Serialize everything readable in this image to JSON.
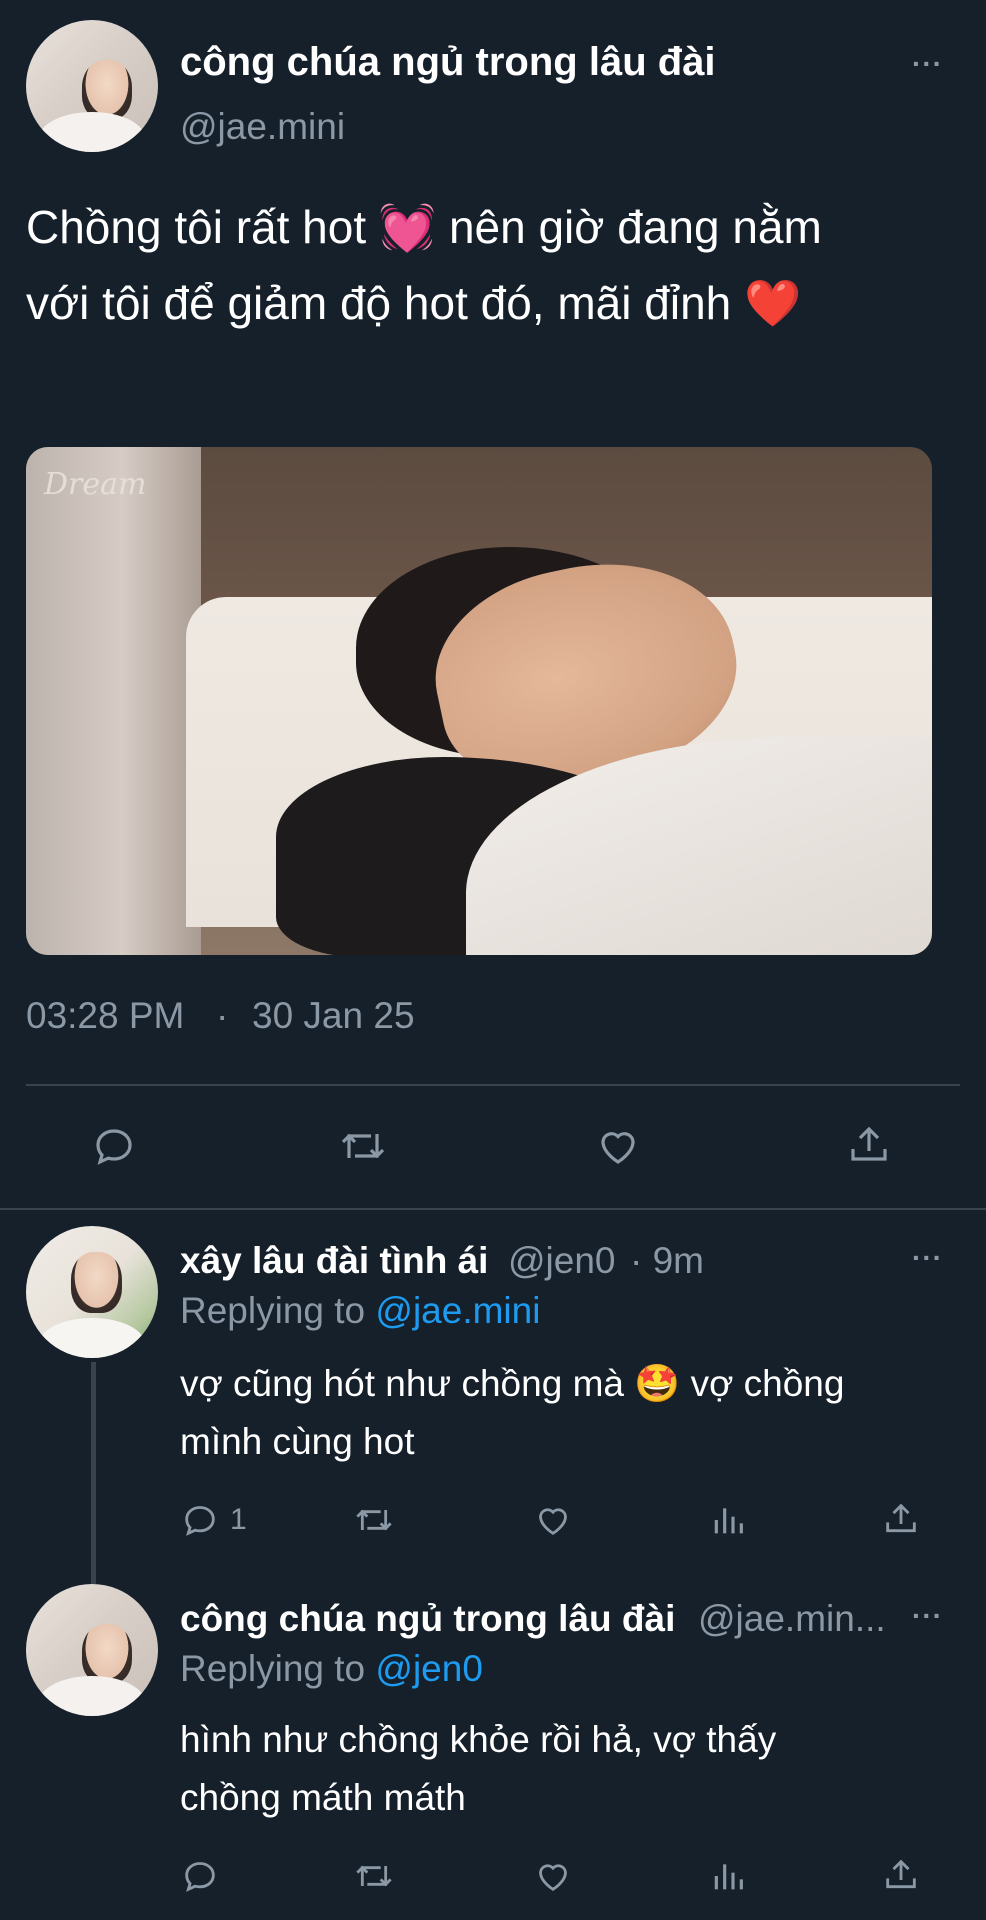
{
  "main_tweet": {
    "display_name": "công chúa ngủ trong lâu đài",
    "handle": "@jae.mini",
    "text_line1": "Chồng tôi rất hot 💓 nên giờ đang nằm",
    "text_line2": "với tôi để giảm độ hot đó, mãi đỉnh ❤️",
    "media_watermark": "Dream",
    "time": "03:28 PM",
    "separator": "·",
    "date": "30 Jan 25",
    "more": "···"
  },
  "actions": {
    "reply_icon": "reply-icon",
    "retweet_icon": "retweet-icon",
    "like_icon": "heart-icon",
    "share_icon": "share-icon"
  },
  "replies": [
    {
      "display_name": "xây lâu đài tình ái",
      "handle": "@jen0",
      "time_ago": "· 9m",
      "replying_prefix": "Replying to",
      "replying_to": "@jae.mini",
      "text_line1": "vợ cũng hót như chồng mà 🤩 vợ chồng",
      "text_line2": "mình cùng hot",
      "reply_count": "1",
      "more": "···"
    },
    {
      "display_name": "công chúa ngủ trong lâu đài",
      "handle": "@jae.min...",
      "replying_prefix": "Replying to",
      "replying_to": "@jen0",
      "text_line1": "hình như chồng khỏe rồi hả, vợ thấy",
      "text_line2": "chồng máth máth",
      "more": "···"
    }
  ],
  "colors": {
    "background": "#15202b",
    "text": "#ffffff",
    "muted": "#8b98a5",
    "link": "#1d9bf0",
    "divider": "#38444d"
  }
}
